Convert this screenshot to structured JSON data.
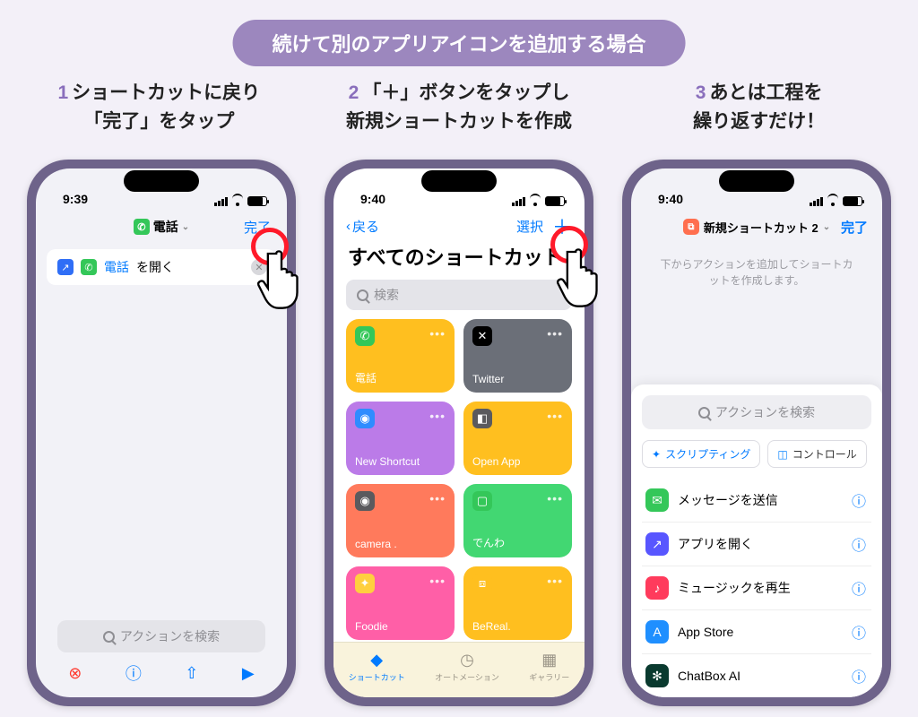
{
  "banner": "続けて別のアプリアイコンを追加する場合",
  "steps": [
    {
      "num": "1",
      "line1": "ショートカットに戻り",
      "line2": "「完了」をタップ"
    },
    {
      "num": "2",
      "line1": "「＋」ボタンをタップし",
      "line2": "新規ショートカットを作成"
    },
    {
      "num": "3",
      "line1": "あとは工程を",
      "line2": "繰り返すだけ！"
    }
  ],
  "phone1": {
    "time": "9:39",
    "title_app": "電話",
    "done": "完了",
    "action_prefix_app": "電話",
    "action_suffix": " を開く",
    "search": "アクションを検索"
  },
  "phone2": {
    "time": "9:40",
    "back": "戻る",
    "select": "選択",
    "heading": "すべてのショートカット",
    "search": "検索",
    "tiles": [
      {
        "label": "電話",
        "bg": "#ffbf1f",
        "icon_bg": "#34c759",
        "icon": "✆"
      },
      {
        "label": "Twitter",
        "bg": "#6b6f78",
        "icon_bg": "#000000",
        "icon": "✕"
      },
      {
        "label": "New Shortcut",
        "bg": "#bb7be8",
        "icon_bg": "#2f8cff",
        "icon": "◉"
      },
      {
        "label": "Open App",
        "bg": "#ffbf1f",
        "icon_bg": "#5a5a5e",
        "icon": "◧"
      },
      {
        "label": "camera .",
        "bg": "#ff7a5c",
        "icon_bg": "#5a5a5e",
        "icon": "◉"
      },
      {
        "label": "でんわ",
        "bg": "#42d772",
        "icon_bg": "#34c759",
        "icon": "▢"
      },
      {
        "label": "Foodie",
        "bg": "#ff5fa7",
        "icon_bg": "#ffcf3f",
        "icon": "✦"
      },
      {
        "label": "BeReal.",
        "bg": "#ffbf1f",
        "icon_bg": "#ffbf1f",
        "icon": "⧈"
      }
    ],
    "tabs": {
      "shortcuts": "ショートカット",
      "automation": "オートメーション",
      "gallery": "ギャラリー"
    }
  },
  "phone3": {
    "time": "9:40",
    "title": "新規ショートカット 2",
    "done": "完了",
    "hint": "下からアクションを追加してショートカットを作成します。",
    "search": "アクションを検索",
    "chips": {
      "scripting": "スクリプティング",
      "control": "コントロール"
    },
    "list": [
      {
        "label": "メッセージを送信",
        "bg": "#34c759",
        "icon": "✉"
      },
      {
        "label": "アプリを開く",
        "bg": "#5856ff",
        "icon": "↗"
      },
      {
        "label": "ミュージックを再生",
        "bg": "#ff3b5c",
        "icon": "♪"
      },
      {
        "label": "App Store",
        "bg": "#1f8fff",
        "icon": "A"
      },
      {
        "label": "ChatBox AI",
        "bg": "#0a3a2f",
        "icon": "✻"
      }
    ]
  }
}
